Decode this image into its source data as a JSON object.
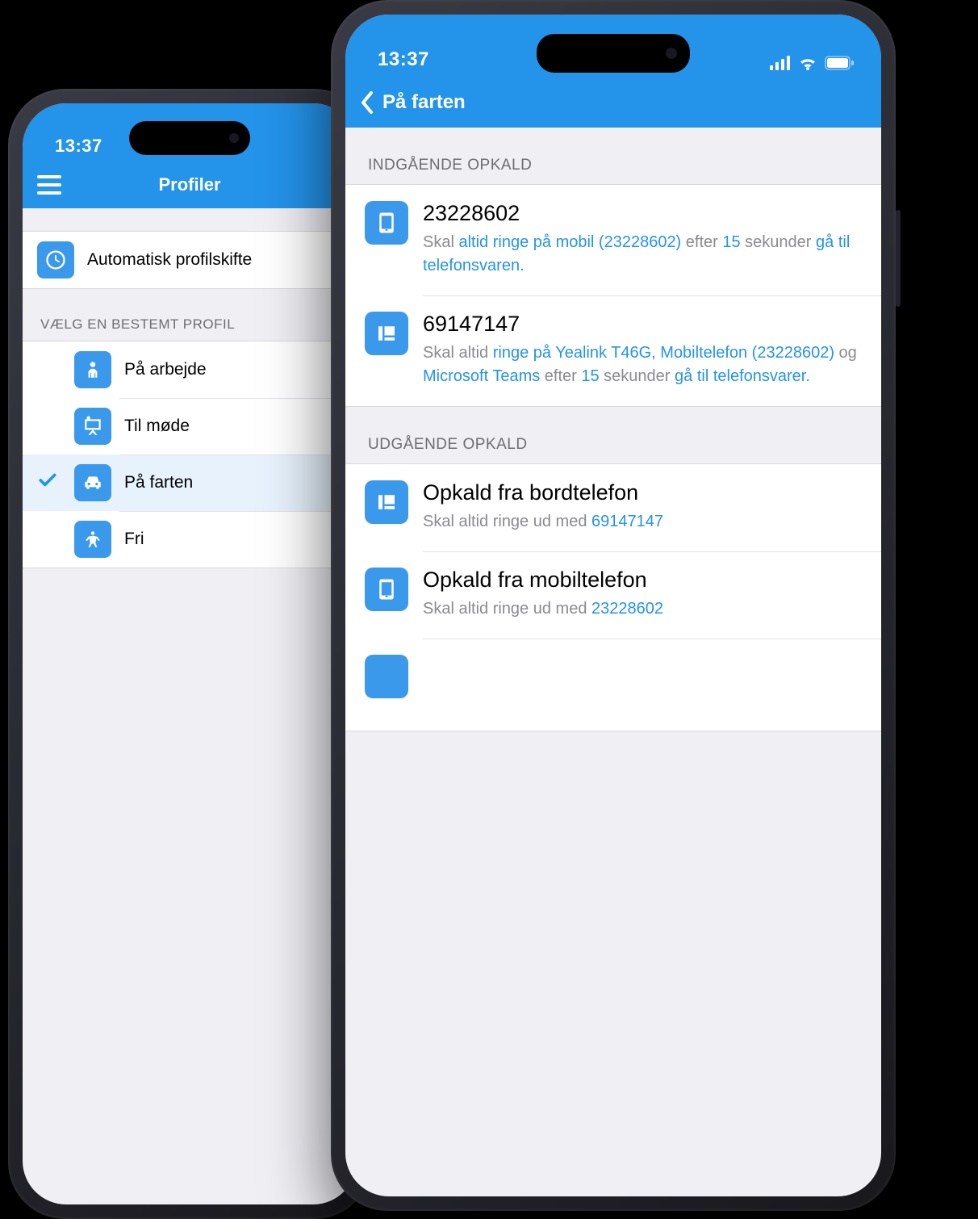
{
  "statusbar": {
    "time": "13:37"
  },
  "back_phone": {
    "header_title": "Profiler",
    "auto_switch_label": "Automatisk profilskifte",
    "section_label": "VÆLG EN BESTEMT PROFIL",
    "profiles": [
      {
        "label": "På arbejde",
        "icon": "worker",
        "selected": false
      },
      {
        "label": "Til møde",
        "icon": "presentation",
        "selected": false
      },
      {
        "label": "På farten",
        "icon": "car",
        "selected": true
      },
      {
        "label": "Fri",
        "icon": "person-free",
        "selected": false
      }
    ]
  },
  "front_phone": {
    "header_title": "På farten",
    "incoming_label": "INDGÅENDE OPKALD",
    "outgoing_label": "UDGÅENDE OPKALD",
    "incoming": [
      {
        "icon": "mobile",
        "number": "23228602",
        "pre1": "Skal ",
        "link1": "altid",
        "mid1": " ",
        "link2": "ringe på mobil (23228602)",
        "mid2": " efter ",
        "link3": "15",
        "mid3": " sekunder ",
        "link4": "gå til telefonsvaren.",
        "tail": ""
      },
      {
        "icon": "deskphone",
        "number": "69147147",
        "pre1": "Skal altid ",
        "link1": "ringe på Yealink T46G, Mobiltelefon (23228602)",
        "mid1": " og ",
        "link2": "Microsoft Teams",
        "mid2": " efter ",
        "link3": "15",
        "mid3": " sekunder ",
        "link4": "gå til telefonsvarer.",
        "tail": ""
      }
    ],
    "outgoing": [
      {
        "icon": "deskphone",
        "title": "Opkald fra bordtelefon",
        "desc_pre": "Skal altid ringe ud med ",
        "desc_link": "69147147"
      },
      {
        "icon": "mobile",
        "title": "Opkald fra mobiltelefon",
        "desc_pre": "Skal altid ringe ud med ",
        "desc_link": "23228602"
      }
    ]
  }
}
